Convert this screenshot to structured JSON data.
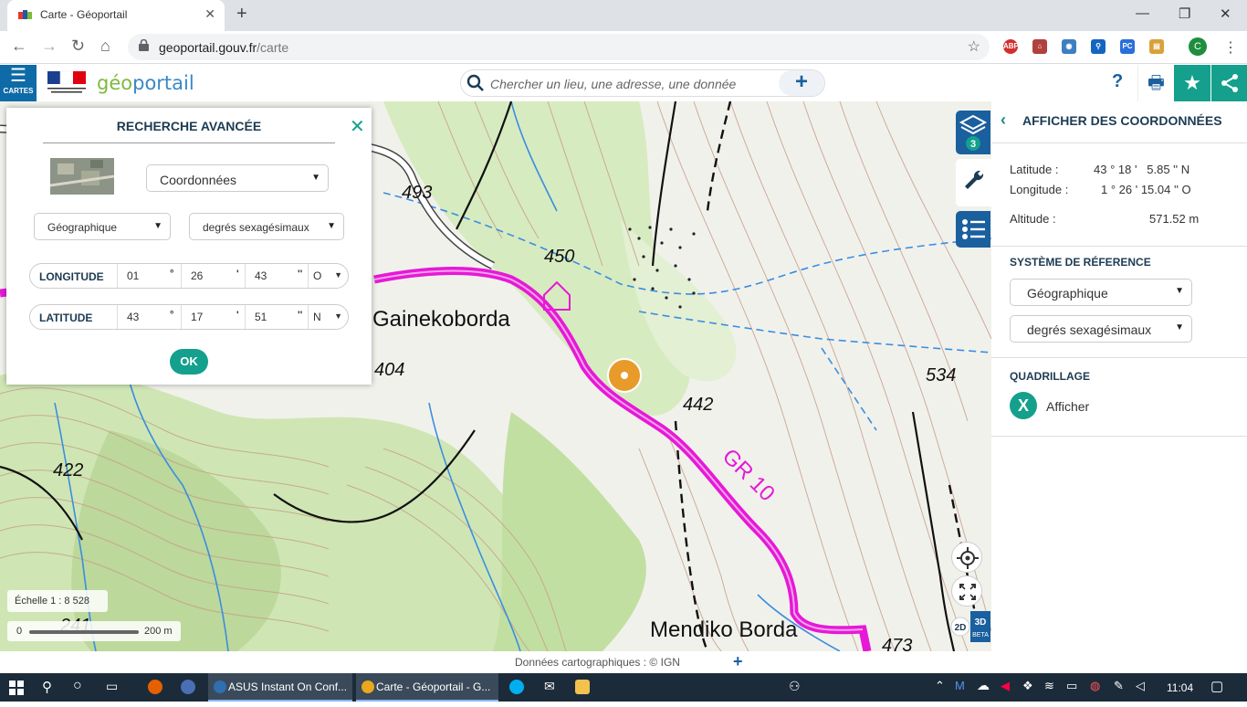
{
  "browser": {
    "tab_title": "Carte - Géoportail",
    "url_domain": "geoportail.gouv.fr",
    "url_path": "/carte",
    "profile_initial": "C"
  },
  "header": {
    "cartes_label": "CARTES",
    "logo_prefix": "géo",
    "logo_suffix": "portail",
    "search_placeholder": "Chercher un lieu, une adresse, une donnée",
    "help_label": "?"
  },
  "advanced_search": {
    "title": "RECHERCHE AVANCÉE",
    "type_select": "Coordonnées",
    "system_select": "Géographique",
    "unit_select": "degrés sexagésimaux",
    "longitude": {
      "label": "LONGITUDE",
      "deg": "01",
      "min": "26",
      "sec": "43",
      "dir": "O"
    },
    "latitude": {
      "label": "LATITUDE",
      "deg": "43",
      "min": "17",
      "sec": "51",
      "dir": "N"
    },
    "ok_label": "OK"
  },
  "map": {
    "labels": [
      "493",
      "450",
      "Gainekoborda",
      "404",
      "442",
      "534",
      "422",
      "GR 10",
      "Mendiko Borda",
      "241",
      "473"
    ],
    "layer_count": "3",
    "scale_text": "Échelle 1 : 8 528",
    "scale_zero": "0",
    "scale_distance": "200 m",
    "mode_2d": "2D",
    "mode_3d": "3D",
    "mode_3d_sub": "BETA",
    "attribution": "Données cartographiques :  ©  IGN"
  },
  "right_panel": {
    "title": "AFFICHER DES COORDONNÉES",
    "lat_label": "Latitude :",
    "lat_value": "43 ° 18 '   5.85 '' N",
    "lon_label": "Longitude :",
    "lon_value": "1 ° 26 ' 15.04 '' O",
    "alt_label": "Altitude :",
    "alt_value": "571.52 m",
    "ref_title": "SYSTÈME DE RÉFERENCE",
    "ref_system": "Géographique",
    "ref_unit": "degrés sexagésimaux",
    "grid_title": "QUADRILLAGE",
    "grid_label": "Afficher"
  },
  "taskbar": {
    "app1": "ASUS Instant On Conf...",
    "app2": "Carte - Géoportail - G...",
    "time": "11:04"
  },
  "colors": {
    "accent": "#14a08c",
    "brand_blue": "#1a5f9e",
    "trail": "#e619d6"
  }
}
